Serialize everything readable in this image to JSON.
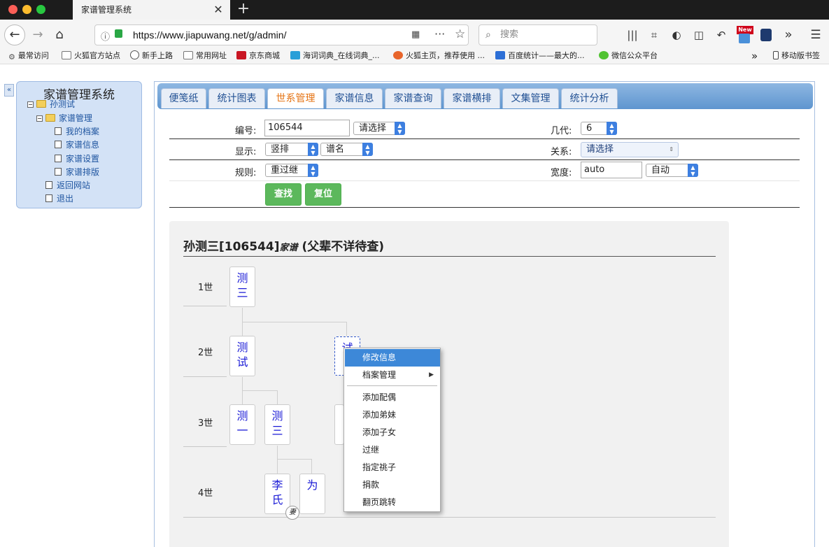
{
  "browser": {
    "tab_title": "家谱管理系统",
    "tab_close": "✕",
    "new_tab": "+",
    "url": "https://www.jiapuwang.net/g/admin/",
    "search_placeholder": "搜索",
    "new_badge": "New",
    "bookmarks": [
      "最常访问",
      "火狐官方站点",
      "新手上路",
      "常用网址",
      "京东商城",
      "海词词典_在线词典_...",
      "火狐主页，推荐使用 ...",
      "百度统计——最大的...",
      "微信公众平台"
    ],
    "more": "»",
    "mobile_bookmarks": "移动版书签"
  },
  "sidebar": {
    "collapse": "«",
    "title": "家谱管理系统",
    "root": "孙测试",
    "group": "家谱管理",
    "items": [
      "我的档案",
      "家谱信息",
      "家谱设置",
      "家谱排版"
    ],
    "links": [
      "返回网站",
      "退出"
    ]
  },
  "tabs": [
    "便笺纸",
    "统计图表",
    "世系管理",
    "家谱信息",
    "家谱查询",
    "家谱横排",
    "文集管理",
    "统计分析"
  ],
  "active_tab": "世系管理",
  "form": {
    "id_label": "编号:",
    "id_value": "106544",
    "id_select": "请选择",
    "gen_label": "几代:",
    "gen_value": "6",
    "display_label": "显示:",
    "display_value": "竖排",
    "name_value": "谱名",
    "relation_label": "关系:",
    "relation_value": "请选择",
    "rule_label": "规则:",
    "rule_value": "重过继",
    "width_label": "宽度:",
    "width_value": "auto",
    "width_select": "自动",
    "find": "查找",
    "reset": "复位"
  },
  "chart": {
    "title_main": "孙测三[106544]",
    "title_italic": "家谱",
    "title_tail": " (父辈不详待查)",
    "generations": [
      "1世",
      "2世",
      "3世",
      "4世"
    ],
    "nodes": {
      "g1": [
        "测",
        "三"
      ],
      "g2a": [
        "测",
        "试"
      ],
      "g2b": [
        "试"
      ],
      "g3a": [
        "测",
        "一"
      ],
      "g3b": [
        "测",
        "三"
      ],
      "g4a": [
        "李",
        "氏"
      ],
      "g4b": [
        "为"
      ]
    },
    "wife_badge": "妻"
  },
  "context_menu": {
    "items": [
      "修改信息",
      "档案管理",
      "添加配偶",
      "添加弟妹",
      "添加子女",
      "过继",
      "指定祧子",
      "捐款",
      "翻页跳转"
    ],
    "highlighted": "修改信息",
    "submenu_arrow": "▶"
  }
}
